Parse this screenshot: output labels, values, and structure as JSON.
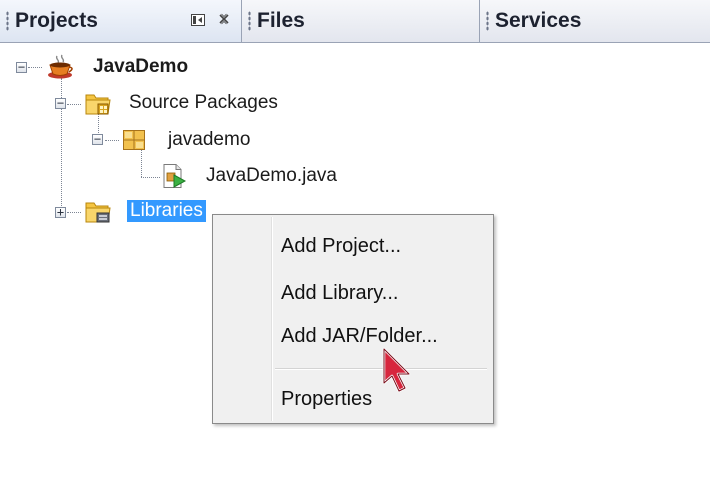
{
  "tabs": [
    {
      "label": "Projects",
      "active": true
    },
    {
      "label": "Files",
      "active": false
    },
    {
      "label": "Services",
      "active": false
    }
  ],
  "tab_icons": {
    "minimize": "minimize-icon",
    "close": "close-icon"
  },
  "tree": {
    "project": {
      "label": "JavaDemo",
      "icon": "coffee-cup-icon",
      "expanded": true
    },
    "source_packages": {
      "label": "Source Packages",
      "icon": "source-folder-icon",
      "expanded": true
    },
    "package": {
      "label": "javademo",
      "icon": "package-icon",
      "expanded": true
    },
    "file": {
      "label": "JavaDemo.java",
      "icon": "java-file-icon"
    },
    "libraries": {
      "label": "Libraries",
      "icon": "library-folder-icon",
      "expanded": false,
      "selected": true
    }
  },
  "context_menu": {
    "items": [
      "Add Project...",
      "Add Library...",
      "Add JAR/Folder...",
      "Properties"
    ]
  },
  "colors": {
    "selection": "#3399ff",
    "menu_background": "#f0f0f0",
    "tab_border": "#9aa3b5"
  }
}
